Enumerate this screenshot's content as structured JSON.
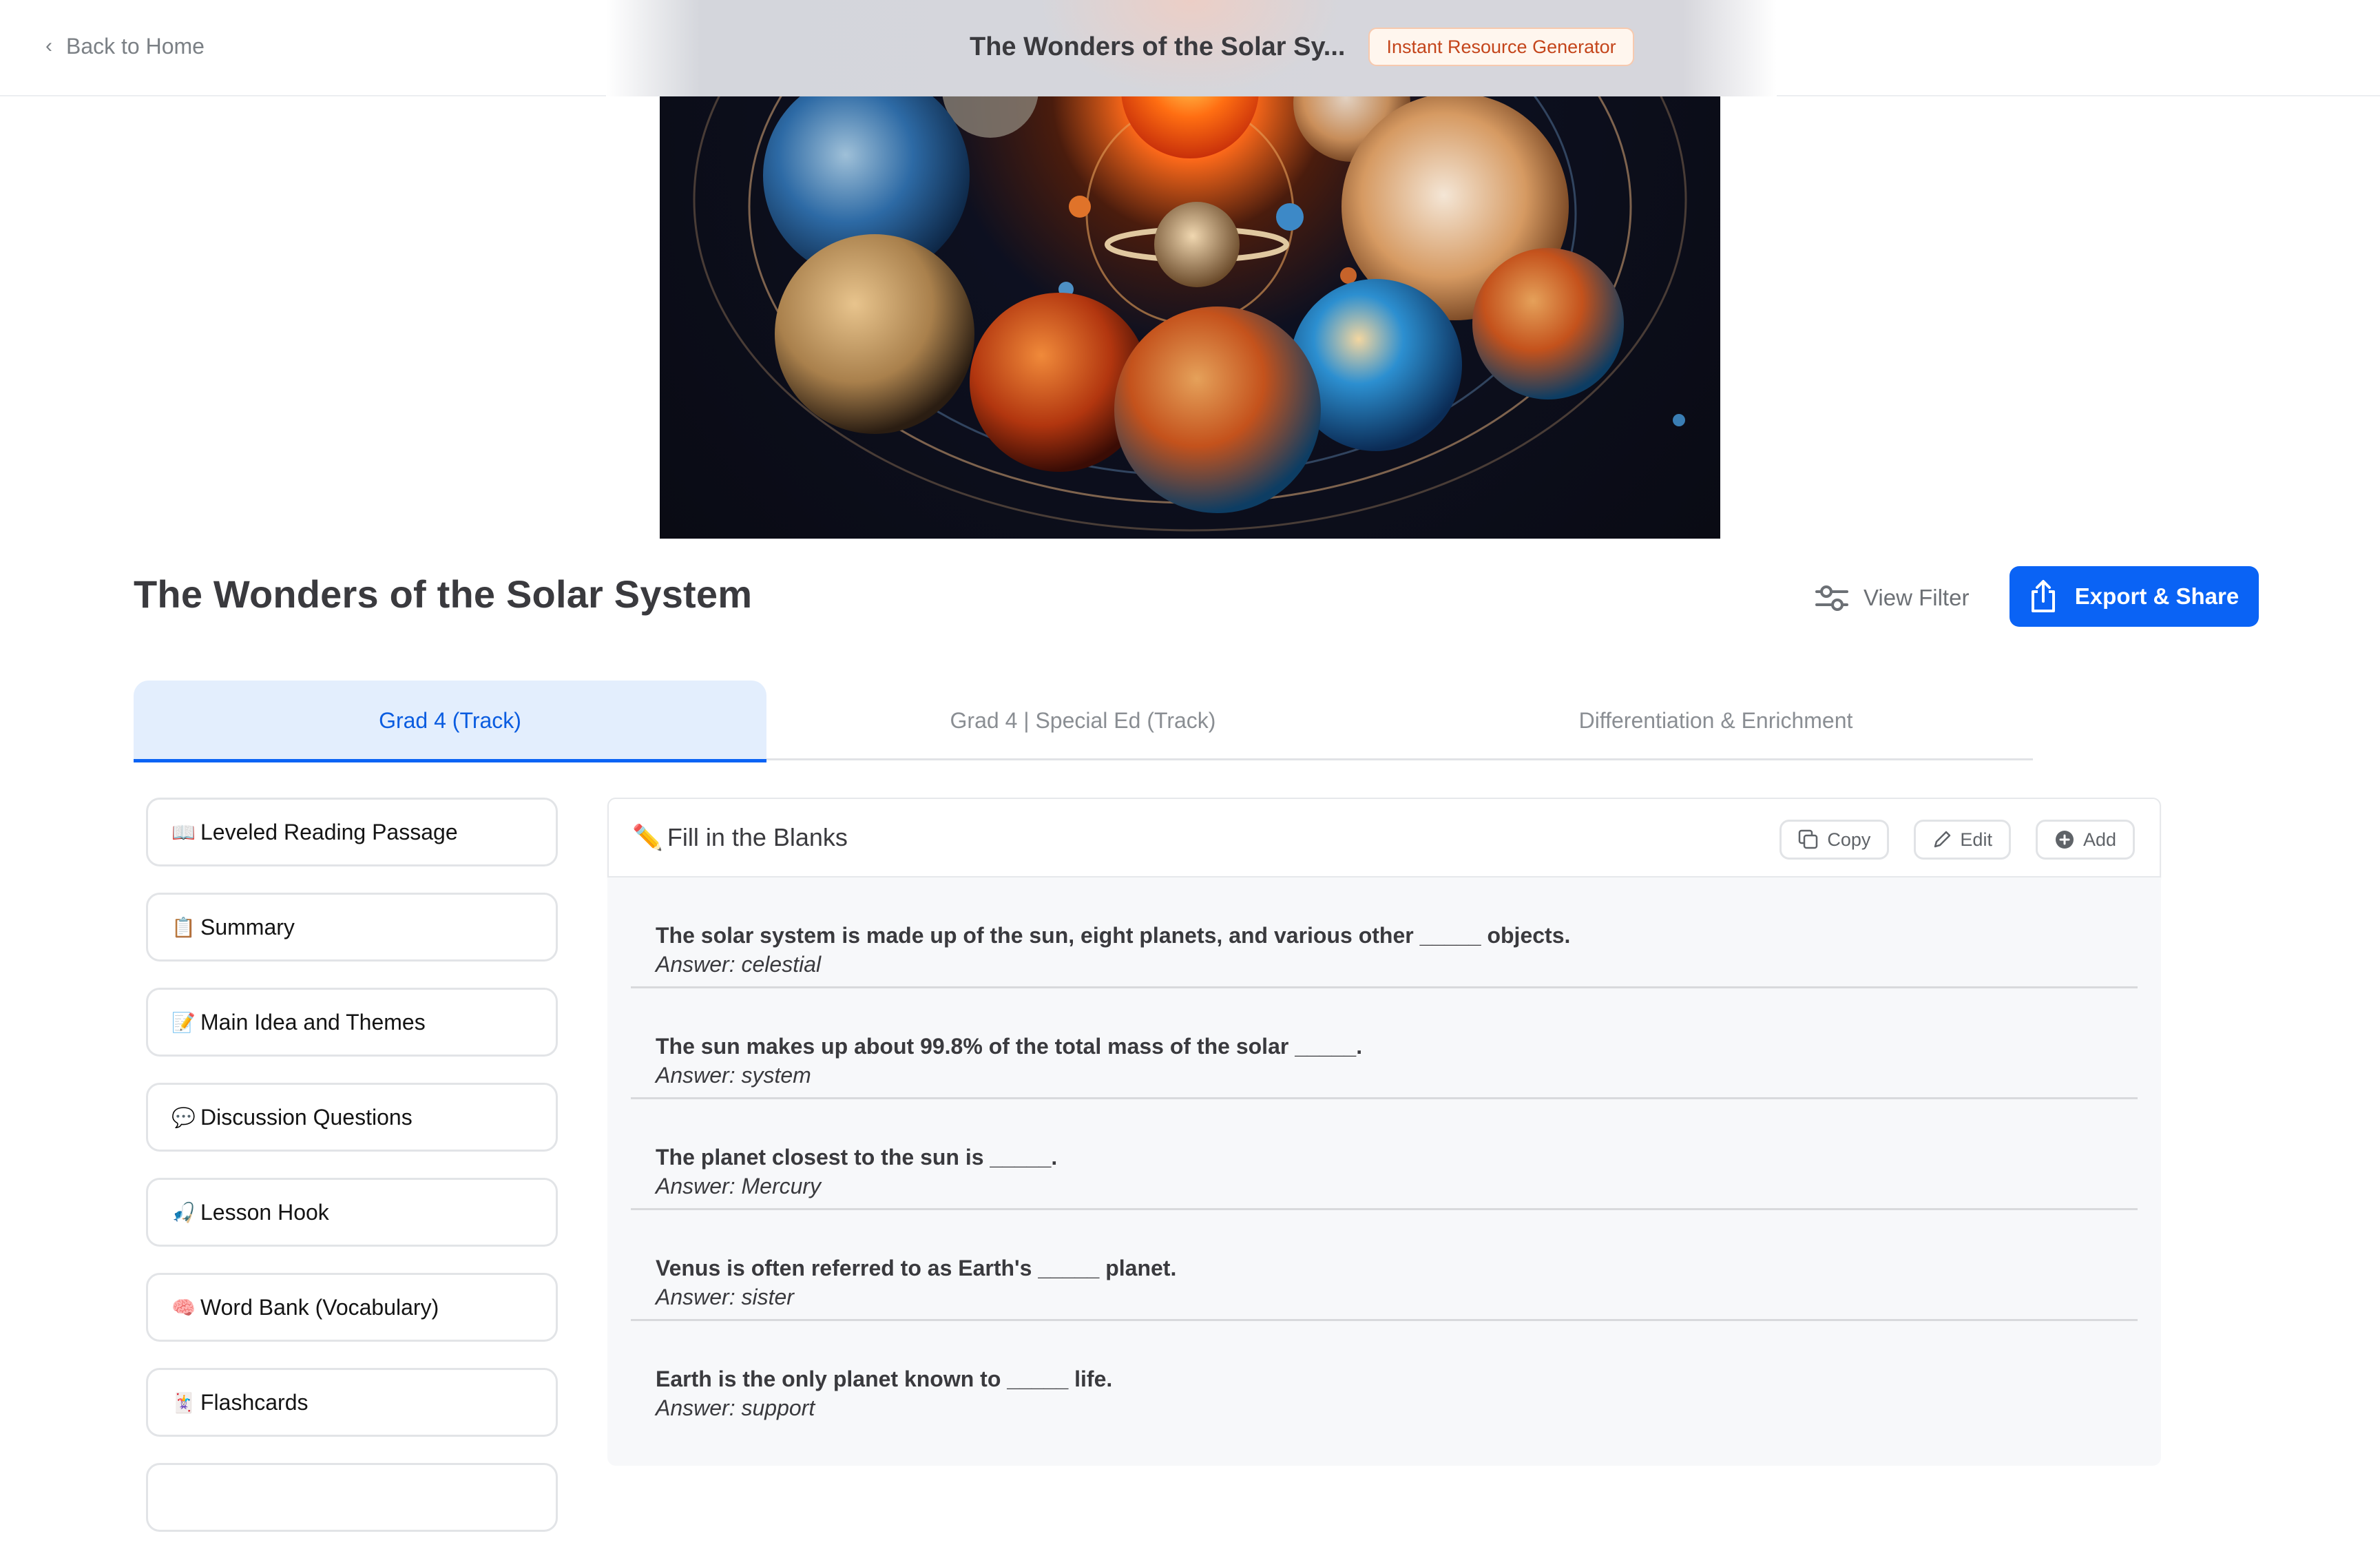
{
  "header": {
    "back_label": "Back to Home",
    "doc_title_truncated": "The Wonders of the Solar Sy...",
    "badge": "Instant Resource Generator"
  },
  "hero": {
    "image_alt": "Illustration of the sun and planets of the solar system"
  },
  "page": {
    "title": "The Wonders of the Solar System",
    "view_filter_label": "View Filter",
    "export_label": "Export & Share"
  },
  "tabs": [
    {
      "label": "Grad 4 (Track)",
      "active": true
    },
    {
      "label": "Grad 4 | Special Ed (Track)",
      "active": false
    },
    {
      "label": "Differentiation & Enrichment",
      "active": false
    }
  ],
  "sidebar": {
    "items": [
      {
        "emoji": "📖",
        "icon": "open-book-icon",
        "label": "Leveled Reading Passage"
      },
      {
        "emoji": "📋",
        "icon": "clipboard-icon",
        "label": "Summary"
      },
      {
        "emoji": "📝",
        "icon": "memo-icon",
        "label": "Main Idea and Themes"
      },
      {
        "emoji": "💬",
        "icon": "speech-bubble-icon",
        "label": "Discussion Questions"
      },
      {
        "emoji": "🎣",
        "icon": "fishing-pole-icon",
        "label": "Lesson Hook"
      },
      {
        "emoji": "🧠",
        "icon": "brain-icon",
        "label": "Word Bank (Vocabulary)"
      },
      {
        "emoji": "🃏",
        "icon": "joker-card-icon",
        "label": "Flashcards"
      },
      {
        "emoji": "",
        "icon": "",
        "label": ""
      }
    ]
  },
  "content": {
    "section_emoji": "✏️",
    "section_title": "Fill in the Blanks",
    "actions": {
      "copy": "Copy",
      "edit": "Edit",
      "add": "Add"
    },
    "questions": [
      {
        "text": "The solar system is made up of the sun, eight planets, and various other _____ objects.",
        "answer": "Answer: celestial"
      },
      {
        "text": "The sun makes up about 99.8% of the total mass of the solar _____.",
        "answer": "Answer: system"
      },
      {
        "text": "The planet closest to the sun is _____.",
        "answer": "Answer: Mercury"
      },
      {
        "text": "Venus is often referred to as Earth's _____ planet.",
        "answer": "Answer: sister"
      },
      {
        "text": "Earth is the only planet known to _____ life.",
        "answer": "Answer: support"
      }
    ]
  },
  "colors": {
    "accent": "#0a63f5",
    "active_tab_bg": "#e3eefd",
    "badge_text": "#c4451b",
    "badge_bg": "#fff6ee"
  }
}
